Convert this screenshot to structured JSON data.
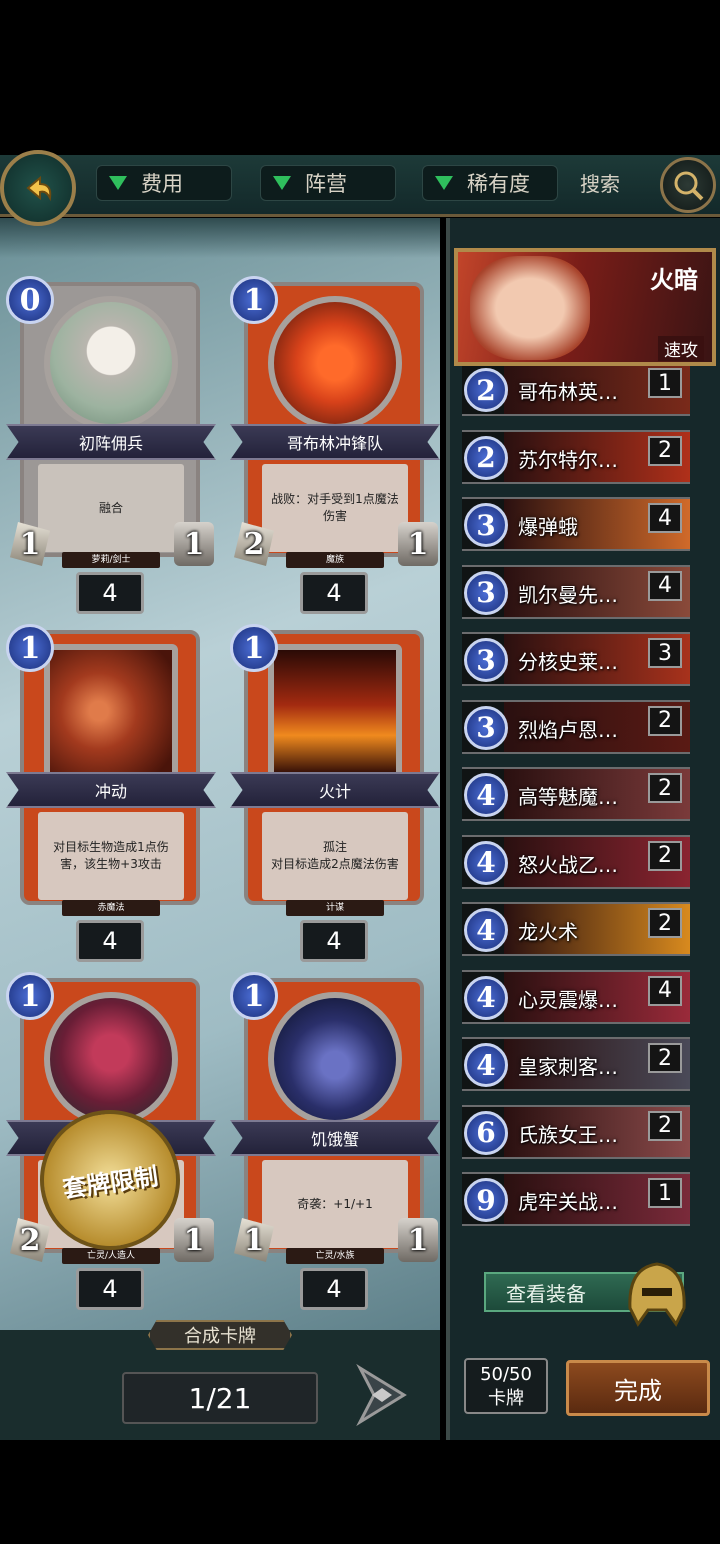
{
  "topbar": {
    "filters": [
      {
        "label": "费用"
      },
      {
        "label": "阵营"
      },
      {
        "label": "稀有度"
      }
    ],
    "search_label": "搜索"
  },
  "cards": [
    {
      "name": "初阵佣兵",
      "cost": "0",
      "text": "融合",
      "tribe": "萝莉/剑士",
      "attack": "1",
      "health": "1",
      "count": "4"
    },
    {
      "name": "哥布林冲锋队",
      "cost": "1",
      "text": "战败：对手受到1点魔法伤害",
      "tribe": "魔族",
      "attack": "2",
      "health": "1",
      "count": "4"
    },
    {
      "name": "冲动",
      "cost": "1",
      "text": "对目标生物造成1点伤害，该生物+3攻击",
      "tribe": "赤魔法",
      "count": "4"
    },
    {
      "name": "火计",
      "cost": "1",
      "text": "孤注\n对目标造成2点魔法伤害",
      "tribe": "计谋",
      "count": "4"
    },
    {
      "name": "",
      "cost": "1",
      "text": "",
      "tribe": "亡灵/人造人",
      "attack": "2",
      "health": "1",
      "count": "4"
    },
    {
      "name": "饥饿蟹",
      "cost": "1",
      "text": "奇袭：+1/+1",
      "tribe": "亡灵/水族",
      "attack": "1",
      "health": "1",
      "count": "4"
    }
  ],
  "seal_text": "套牌限制",
  "craft_label": "合成卡牌",
  "pagination": "1/21",
  "hero": {
    "name": "火暗",
    "tag": "速攻"
  },
  "deck": [
    {
      "cost": "2",
      "name": "哥布林英…",
      "count": "1"
    },
    {
      "cost": "2",
      "name": "苏尔特尔…",
      "count": "2"
    },
    {
      "cost": "3",
      "name": "爆弹蛾",
      "count": "4"
    },
    {
      "cost": "3",
      "name": "凯尔曼先…",
      "count": "4"
    },
    {
      "cost": "3",
      "name": "分核史莱…",
      "count": "3"
    },
    {
      "cost": "3",
      "name": "烈焰卢恩…",
      "count": "2"
    },
    {
      "cost": "4",
      "name": "高等魅魔…",
      "count": "2"
    },
    {
      "cost": "4",
      "name": "怒火战乙…",
      "count": "2"
    },
    {
      "cost": "4",
      "name": "龙火术",
      "count": "2"
    },
    {
      "cost": "4",
      "name": "心灵震爆…",
      "count": "4"
    },
    {
      "cost": "4",
      "name": "皇家刺客…",
      "count": "2"
    },
    {
      "cost": "6",
      "name": "氏族女王…",
      "count": "2"
    },
    {
      "cost": "9",
      "name": "虎牢关战…",
      "count": "1"
    }
  ],
  "equip_label": "查看装备",
  "deck_count": {
    "value": "50/50",
    "label": "卡牌"
  },
  "done_label": "完成",
  "colors": {
    "accent_green": "#2fbf5d",
    "mana_blue": "#3b5fc8",
    "card_red": "#c9481c",
    "gold": "#b08a4a"
  }
}
